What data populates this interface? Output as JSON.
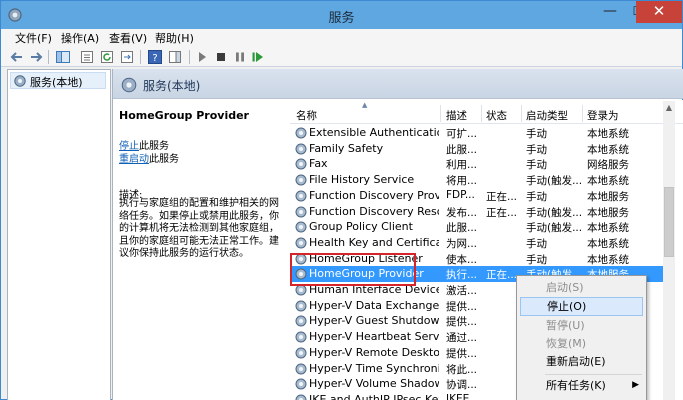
{
  "window": {
    "title": "服务"
  },
  "menu": [
    {
      "label": "文件(F)"
    },
    {
      "label": "操作(A)"
    },
    {
      "label": "查看(V)"
    },
    {
      "label": "帮助(H)"
    }
  ],
  "tree": {
    "root": "服务(本地)"
  },
  "content": {
    "header": "服务(本地)"
  },
  "detail": {
    "service_name": "HomeGroup Provider",
    "stop_link": "停止",
    "stop_suffix": "此服务",
    "restart_link": "重启动",
    "restart_suffix": "此服务",
    "desc_label": "描述:",
    "description": "执行与家庭组的配置和维护相关的网络任务。如果停止或禁用此服务，你的计算机将无法检测到其他家庭组，且你的家庭组可能无法正常工作。建议你保持此服务的运行状态。"
  },
  "columns": {
    "name": "名称",
    "desc": "描述",
    "status": "状态",
    "start": "启动类型",
    "logon": "登录为"
  },
  "rows": [
    {
      "name": "Extensible Authentication...",
      "desc": "可扩...",
      "status": "",
      "start": "手动",
      "logon": "本地系统"
    },
    {
      "name": "Family Safety",
      "desc": "此服...",
      "status": "",
      "start": "手动",
      "logon": "本地系统"
    },
    {
      "name": "Fax",
      "desc": "利用...",
      "status": "",
      "start": "手动",
      "logon": "网络服务"
    },
    {
      "name": "File History Service",
      "desc": "将用...",
      "status": "",
      "start": "手动(触发...",
      "logon": "本地系统"
    },
    {
      "name": "Function Discovery Provi...",
      "desc": "FDP...",
      "status": "正在...",
      "start": "手动",
      "logon": "本地服务"
    },
    {
      "name": "Function Discovery Reso...",
      "desc": "发布...",
      "status": "正在...",
      "start": "手动(触发...",
      "logon": "本地服务"
    },
    {
      "name": "Group Policy Client",
      "desc": "此服...",
      "status": "",
      "start": "手动(触发...",
      "logon": "本地系统"
    },
    {
      "name": "Health Key and Certificat...",
      "desc": "为网...",
      "status": "",
      "start": "手动",
      "logon": "本地系统"
    },
    {
      "name": "HomeGroup Listener",
      "desc": "使本...",
      "status": "",
      "start": "手动",
      "logon": "本地系统"
    },
    {
      "name": "HomeGroup Provider",
      "desc": "执行...",
      "status": "正在...",
      "start": "手动(触发...",
      "logon": "本地服务"
    },
    {
      "name": "Human Interface Device ...",
      "desc": "激活...",
      "status": "",
      "start": "",
      "logon": ""
    },
    {
      "name": "Hyper-V Data Exchange ...",
      "desc": "提供...",
      "status": "",
      "start": "",
      "logon": ""
    },
    {
      "name": "Hyper-V Guest Shutdown...",
      "desc": "提供...",
      "status": "",
      "start": "",
      "logon": ""
    },
    {
      "name": "Hyper-V Heartbeat Service",
      "desc": "通过...",
      "status": "",
      "start": "",
      "logon": ""
    },
    {
      "name": "Hyper-V Remote Deskto...",
      "desc": "提供...",
      "status": "",
      "start": "",
      "logon": ""
    },
    {
      "name": "Hyper-V Time Synchroniz...",
      "desc": "将此...",
      "status": "",
      "start": "",
      "logon": ""
    },
    {
      "name": "Hyper-V Volume Shadow...",
      "desc": "协调...",
      "status": "",
      "start": "",
      "logon": ""
    },
    {
      "name": "IKE and AuthIP IPsec Key...",
      "desc": "IKEE...",
      "status": "",
      "start": "",
      "logon": ""
    }
  ],
  "context_menu": {
    "start": "启动(S)",
    "stop": "停止(O)",
    "pause": "暂停(U)",
    "resume": "恢复(M)",
    "restart": "重新启动(E)",
    "all_tasks": "所有任务(K)"
  }
}
